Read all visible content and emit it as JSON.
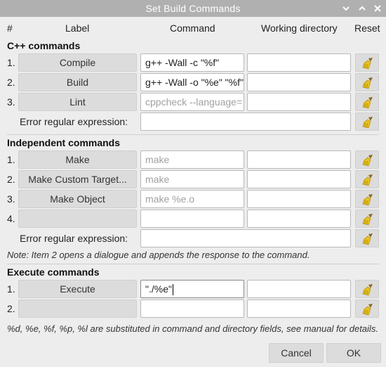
{
  "window": {
    "title": "Set Build Commands"
  },
  "columns": {
    "num": "#",
    "label": "Label",
    "command": "Command",
    "workdir": "Working directory",
    "reset": "Reset"
  },
  "cpp": {
    "title": "C++ commands",
    "rows": [
      {
        "num": "1.",
        "label": "Compile",
        "command": "g++ -Wall -c \"%f\"",
        "command_placeholder": "",
        "workdir": ""
      },
      {
        "num": "2.",
        "label": "Build",
        "command": "g++ -Wall -o \"%e\" \"%f\"",
        "command_placeholder": "",
        "workdir": ""
      },
      {
        "num": "3.",
        "label": "Lint",
        "command": "",
        "command_placeholder": "cppcheck --language=",
        "workdir": ""
      }
    ],
    "regex_label": "Error regular expression:",
    "regex_value": ""
  },
  "independent": {
    "title": "Independent commands",
    "rows": [
      {
        "num": "1.",
        "label": "Make",
        "command": "",
        "command_placeholder": "make",
        "workdir": ""
      },
      {
        "num": "2.",
        "label": "Make Custom Target...",
        "command": "",
        "command_placeholder": "make",
        "workdir": ""
      },
      {
        "num": "3.",
        "label": "Make Object",
        "command": "",
        "command_placeholder": "make %e.o",
        "workdir": ""
      },
      {
        "num": "4.",
        "label": "",
        "command": "",
        "command_placeholder": "",
        "workdir": ""
      }
    ],
    "regex_label": "Error regular expression:",
    "regex_value": "",
    "note": "Note: Item 2 opens a dialogue and appends the response to the command."
  },
  "execute": {
    "title": "Execute commands",
    "rows": [
      {
        "num": "1.",
        "label": "Execute",
        "command": "\"./%e\"",
        "command_placeholder": "",
        "workdir": ""
      },
      {
        "num": "2.",
        "label": "",
        "command": "",
        "command_placeholder": "",
        "workdir": ""
      }
    ],
    "note": "%d, %e, %f, %p, %l are substituted in command and directory fields, see manual for details."
  },
  "buttons": {
    "cancel": "Cancel",
    "ok": "OK"
  },
  "icons": {
    "reset": "broom-icon",
    "minimize": "chevron-down-icon",
    "maximize": "chevron-up-icon",
    "close": "close-icon"
  }
}
